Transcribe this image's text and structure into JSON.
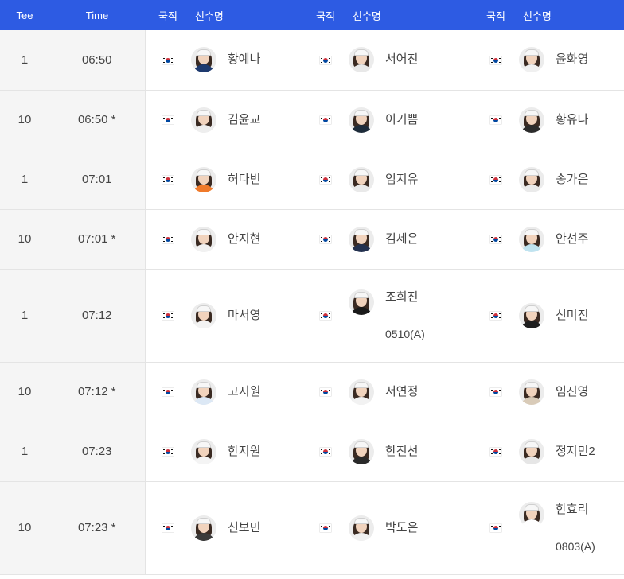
{
  "header": {
    "tee": "Tee",
    "time": "Time",
    "nationality": "국적",
    "player": "선수명"
  },
  "rows": [
    {
      "tee": "1",
      "time": "06:50",
      "players": [
        {
          "name": "황예나",
          "shirt": "#1e3a6e"
        },
        {
          "name": "서어진",
          "shirt": "#e8e8e8"
        },
        {
          "name": "윤화영",
          "shirt": "#f0f0f0"
        }
      ]
    },
    {
      "tee": "10",
      "time": "06:50 *",
      "players": [
        {
          "name": "김윤교",
          "shirt": "#eeeeee"
        },
        {
          "name": "이기쁨",
          "shirt": "#1d2b3a"
        },
        {
          "name": "황유나",
          "shirt": "#2b2b2b"
        }
      ]
    },
    {
      "tee": "1",
      "time": "07:01",
      "players": [
        {
          "name": "허다빈",
          "shirt": "#f07a2a"
        },
        {
          "name": "임지유",
          "shirt": "#e9e9e9"
        },
        {
          "name": "송가은",
          "shirt": "#eaeaea"
        }
      ]
    },
    {
      "tee": "10",
      "time": "07:01 *",
      "players": [
        {
          "name": "안지현",
          "shirt": "#f1f1f1"
        },
        {
          "name": "김세은",
          "shirt": "#23314f"
        },
        {
          "name": "안선주",
          "shirt": "#bfe3f0"
        }
      ]
    },
    {
      "tee": "1",
      "time": "07:12",
      "players": [
        {
          "name": "마서영",
          "shirt": "#f3f3f3"
        },
        {
          "name": "조희진",
          "affil": "0510(A)",
          "shirt": "#1a1a1a"
        },
        {
          "name": "신미진",
          "shirt": "#1f1f1f"
        }
      ]
    },
    {
      "tee": "10",
      "time": "07:12 *",
      "players": [
        {
          "name": "고지원",
          "shirt": "#dce8f5"
        },
        {
          "name": "서연정",
          "shirt": "#f2f2f2"
        },
        {
          "name": "임진영",
          "shirt": "#d9cbb8"
        }
      ]
    },
    {
      "tee": "1",
      "time": "07:23",
      "players": [
        {
          "name": "한지원",
          "shirt": "#f4f4f4"
        },
        {
          "name": "한진선",
          "shirt": "#2a2a2a"
        },
        {
          "name": "정지민2",
          "shirt": "#e6e6e6"
        }
      ]
    },
    {
      "tee": "10",
      "time": "07:23 *",
      "players": [
        {
          "name": "신보민",
          "shirt": "#3a3a3a"
        },
        {
          "name": "박도은",
          "shirt": "#f0f0f0"
        },
        {
          "name": "한효리",
          "affil": "0803(A)",
          "shirt": "#ffffff"
        }
      ]
    }
  ]
}
